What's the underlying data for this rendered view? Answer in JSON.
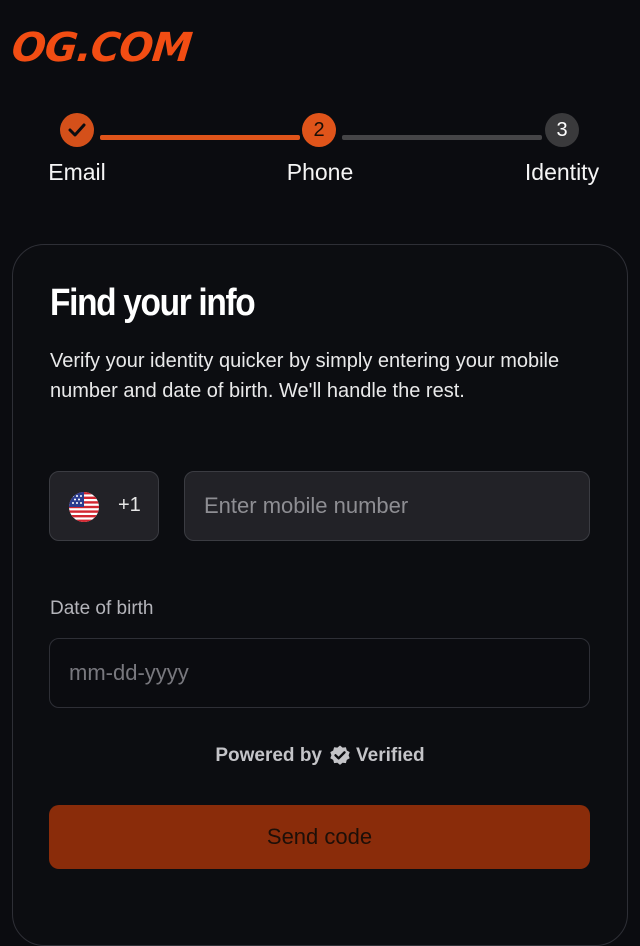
{
  "brand": {
    "logo_text": "OG.COM",
    "accent": "#f24d13"
  },
  "stepper": {
    "steps": [
      {
        "label": "Email",
        "status": "complete",
        "icon": "check-icon"
      },
      {
        "label": "Phone",
        "number": "2",
        "status": "current"
      },
      {
        "label": "Identity",
        "number": "3",
        "status": "upcoming"
      }
    ]
  },
  "form": {
    "title": "Find your info",
    "description": "Verify your identity quicker by simply entering your mobile number and date of birth. We'll handle the rest.",
    "country": {
      "flag_icon": "us-flag-icon",
      "dial_code": "+1"
    },
    "phone": {
      "placeholder": "Enter mobile number",
      "value": ""
    },
    "dob": {
      "label": "Date of birth",
      "placeholder": "mm-dd-yyyy",
      "value": ""
    },
    "powered_by": {
      "prefix": "Powered by",
      "brand": "Verified",
      "icon": "verified-badge-icon"
    },
    "submit": {
      "label": "Send code",
      "color": "#8a2c0a"
    }
  }
}
